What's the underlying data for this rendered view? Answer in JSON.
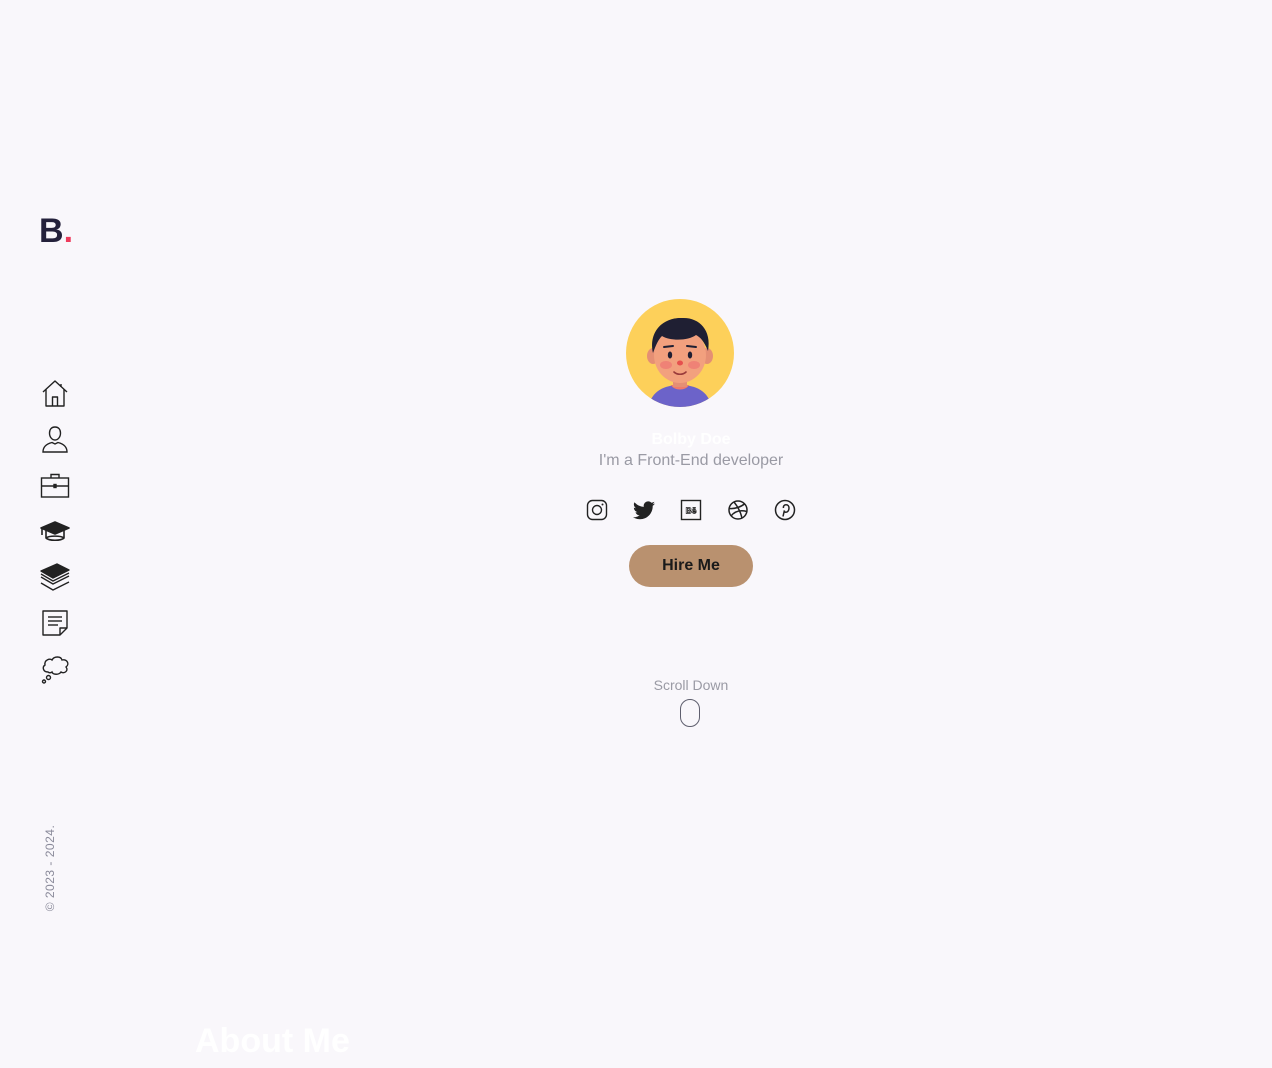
{
  "logo": {
    "letter": "B",
    "dot": "."
  },
  "nav": [
    {
      "id": "home",
      "icon": "home-icon"
    },
    {
      "id": "about",
      "icon": "user-icon"
    },
    {
      "id": "portfolio",
      "icon": "briefcase-icon"
    },
    {
      "id": "education",
      "icon": "graduation-cap-icon"
    },
    {
      "id": "services",
      "icon": "layers-icon"
    },
    {
      "id": "blog",
      "icon": "note-icon"
    },
    {
      "id": "contact",
      "icon": "thought-cloud-icon"
    }
  ],
  "copyright": "© 2023 - 2024.",
  "hero": {
    "name": "Bolby Doe",
    "role": "I'm a Front-End developer",
    "hire_label": "Hire Me",
    "scroll_label": "Scroll Down"
  },
  "socials": [
    {
      "id": "instagram",
      "icon": "instagram-icon"
    },
    {
      "id": "twitter",
      "icon": "twitter-icon"
    },
    {
      "id": "behance",
      "icon": "behance-icon"
    },
    {
      "id": "dribbble",
      "icon": "dribbble-icon"
    },
    {
      "id": "pinterest",
      "icon": "pinterest-icon"
    }
  ],
  "about": {
    "title": "About Me"
  },
  "colors": {
    "background": "#f9f7fb",
    "accent": "#ee3b5c",
    "button": "#b9916f",
    "avatar_bg": "#fdd05a"
  }
}
